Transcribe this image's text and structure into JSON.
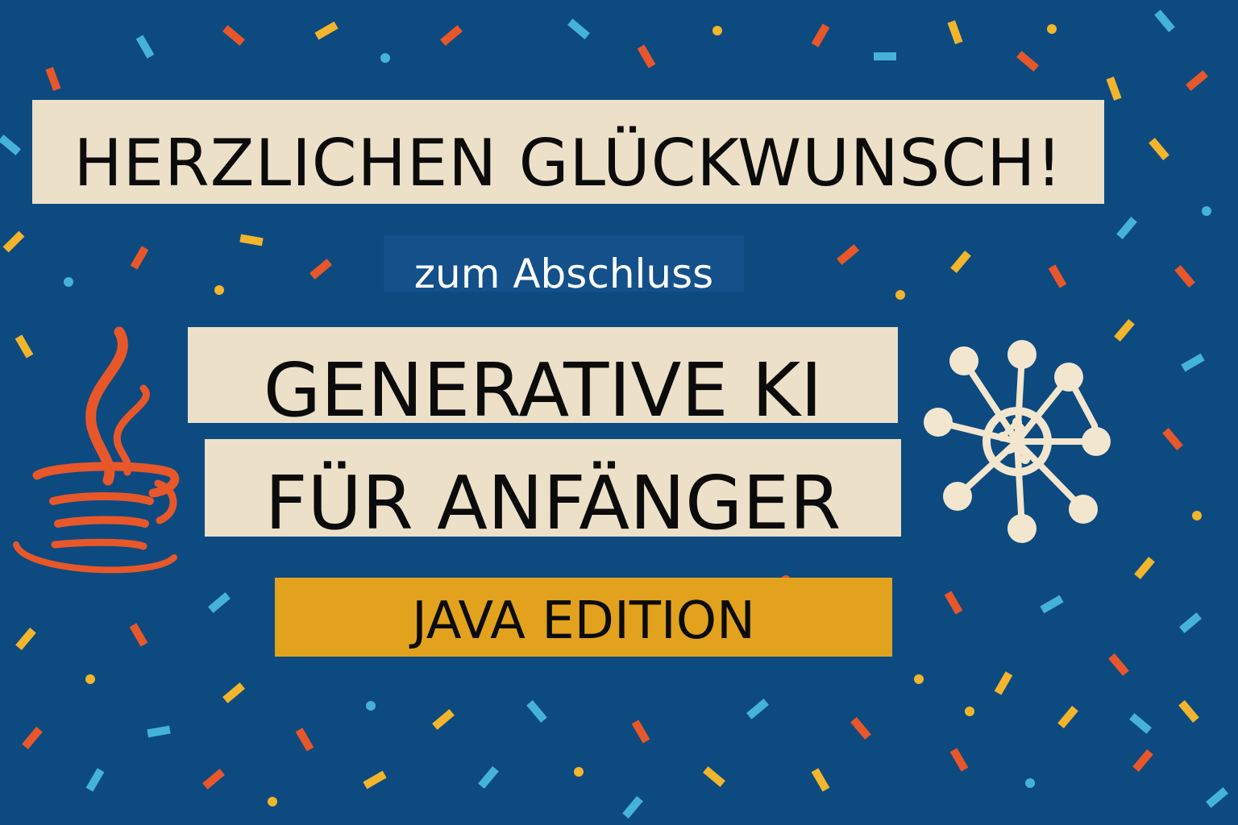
{
  "headline": "HERZLICHEN GLÜCKWUNSCH!",
  "subheadline": "zum Abschluss",
  "course_title_line1": "GENERATIVE KI",
  "course_title_line2": "FÜR ANFÄNGER",
  "edition": "JAVA EDITION",
  "icons": {
    "left": "java-coffee-cup-icon",
    "right": "ai-neural-network-icon"
  },
  "colors": {
    "background": "#0d4a80",
    "banner_cream": "#ece0c9",
    "banner_gold": "#e2a21e",
    "java_orange": "#e8572a",
    "network_cream": "#f3e6cf",
    "confetti": [
      "#e8572a",
      "#f2b52c",
      "#45b3d9"
    ]
  }
}
